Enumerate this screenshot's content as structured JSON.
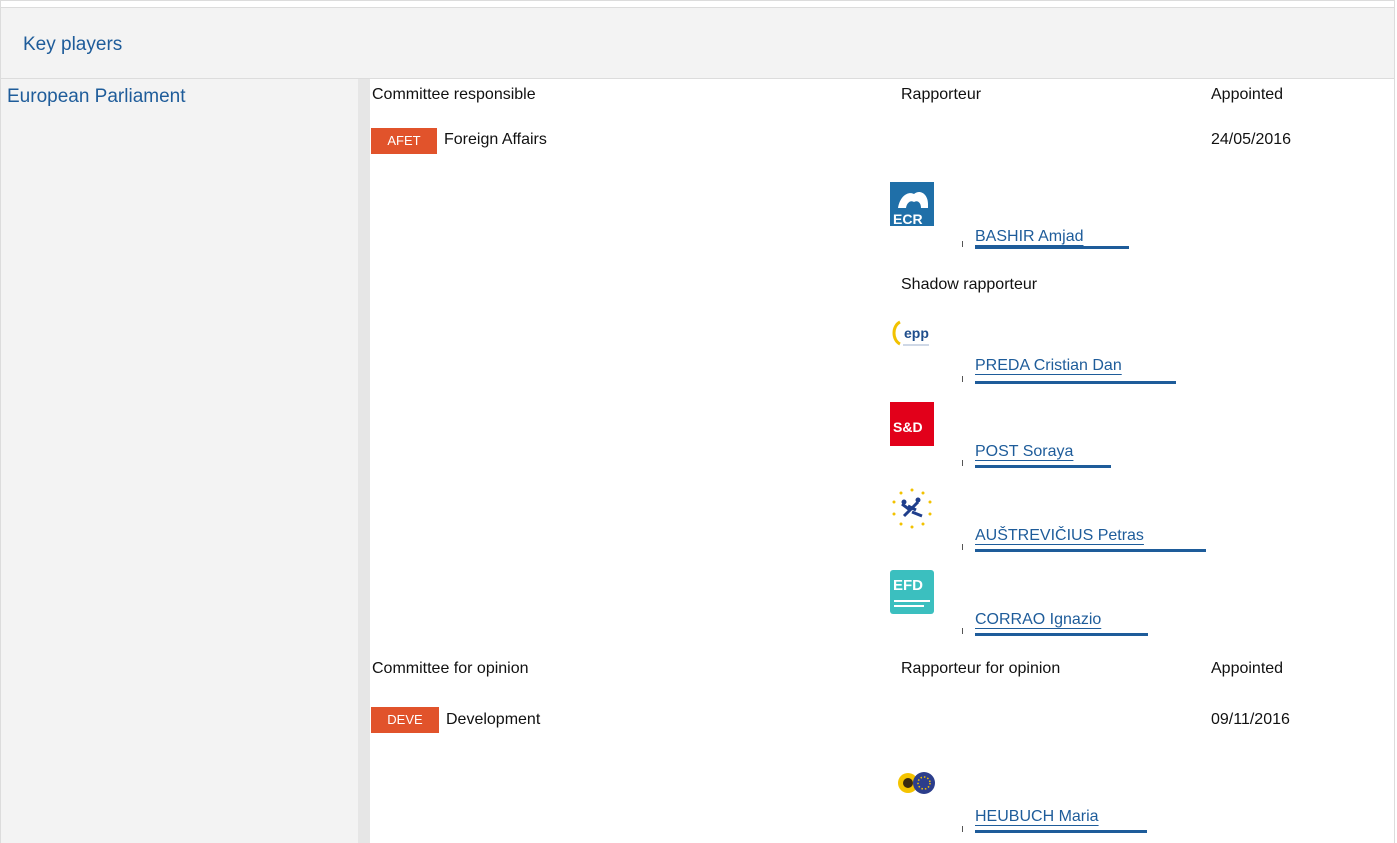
{
  "header": {
    "title": "Key players"
  },
  "institution": {
    "name": "European Parliament"
  },
  "responsible": {
    "col_committee": "Committee responsible",
    "col_rapporteur": "Rapporteur",
    "col_appointed": "Appointed",
    "committee_code": "AFET",
    "committee_name": "Foreign Affairs",
    "appointed_date": "24/05/2016",
    "rapporteur": {
      "name": "BASHIR Amjad",
      "group_logo": "ecr-logo",
      "logo_text": "ECR"
    },
    "shadow_label": "Shadow rapporteur",
    "shadows": [
      {
        "name": "PREDA Cristian Dan",
        "group_logo": "epp-logo",
        "logo_text": "epp"
      },
      {
        "name": "POST Soraya",
        "group_logo": "sd-logo",
        "logo_text": "S&D"
      },
      {
        "name": "AUŠTREVIČIUS Petras",
        "group_logo": "alde-logo"
      },
      {
        "name": "CORRAO Ignazio",
        "group_logo": "efdd-logo",
        "logo_text": "EFD"
      }
    ]
  },
  "opinion": {
    "col_committee": "Committee for opinion",
    "col_rapporteur": "Rapporteur for opinion",
    "col_appointed": "Appointed",
    "committee_code": "DEVE",
    "committee_name": "Development",
    "appointed_date": "09/11/2016",
    "rapporteur": {
      "name": "HEUBUCH Maria",
      "group_logo": "greens-efa-logo"
    }
  },
  "colors": {
    "link": "#1e5c9a",
    "badge": "#e1532b",
    "panel": "#f3f3f3"
  }
}
